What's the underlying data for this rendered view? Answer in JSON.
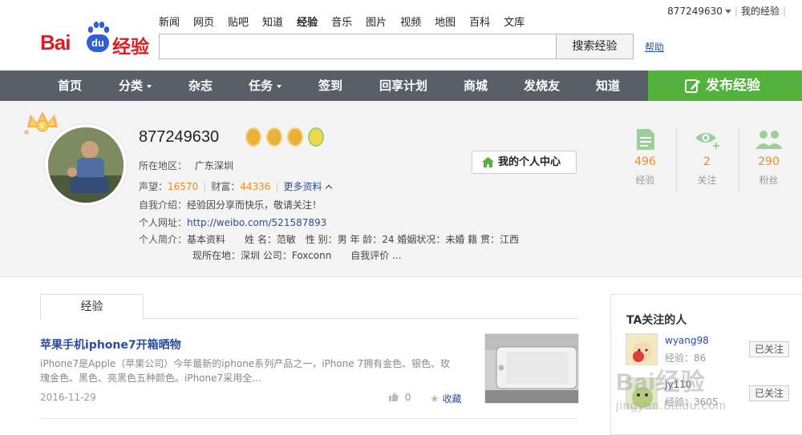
{
  "header": {
    "logo_text": "Bai",
    "logo_du": "du",
    "logo_suffix": "经验",
    "nav_links": [
      "新闻",
      "网页",
      "贴吧",
      "知道",
      "经验",
      "音乐",
      "图片",
      "视频",
      "地图",
      "百科",
      "文库"
    ],
    "active_nav": "经验",
    "search_placeholder": "",
    "search_button": "搜索经验",
    "help": "帮助",
    "user_name": "877249630",
    "my_exp": "我的经验"
  },
  "menu": {
    "items": [
      "首页",
      "分类",
      "杂志",
      "任务",
      "签到",
      "回享计划",
      "商城",
      "发烧友",
      "知道"
    ],
    "publish": "发布经验"
  },
  "profile": {
    "username": "877249630",
    "location_label": "所在地区：",
    "location": "广东深圳",
    "reputation_label": "声望：",
    "reputation": "16570",
    "wealth_label": "财富：",
    "wealth": "44336",
    "more_info": "更多资料",
    "intro_label": "自我介绍：",
    "intro": "经验因分享而快乐，敬请关注！",
    "website_label": "个人网址：",
    "website": "http://weibo.com/521587893",
    "brief_label": "个人简介：",
    "brief_line1": "基本资料　　姓 名：范敏　性 别：男 年 龄：24 婚姻状况：未婚 籍 贯：江西",
    "brief_line2": "现所在地：深圳 公司：Foxconn　　自我评价 ...",
    "center_button": "我的个人中心",
    "crown_text": "6",
    "stats": [
      {
        "num": "496",
        "label": "经验",
        "icon": "document-icon"
      },
      {
        "num": "2",
        "label": "关注",
        "icon": "eye-plus-icon"
      },
      {
        "num": "290",
        "label": "粉丝",
        "icon": "users-icon"
      }
    ]
  },
  "content": {
    "tab": "经验",
    "article": {
      "title": "苹果手机iphone7开箱晒物",
      "desc": "iPhone7是Apple（苹果公司）今年最新的iphone系列产品之一，iPhone 7拥有金色、银色、玫瑰金色、黑色、亮黑色五种颜色。iPhone7采用全...",
      "date": "2016-11-29",
      "likes": "0",
      "fav": "收藏"
    }
  },
  "sidebar": {
    "title": "TA关注的人",
    "follows": [
      {
        "name": "wyang98",
        "exp_label": "经验：",
        "exp": "86",
        "button": "已关注"
      },
      {
        "name": "Jy110",
        "exp_label": "经验：",
        "exp": "3605",
        "button": "已关注"
      }
    ]
  },
  "watermark": {
    "line1": "Bai经验",
    "line2": "jingyan.baidu.com"
  },
  "colors": {
    "menu_bg": "#5a5e66",
    "publish_bg": "#53b23b",
    "link": "#2c4d9e",
    "orange": "#f28a21",
    "stat_icon": "#9ccf9a"
  }
}
